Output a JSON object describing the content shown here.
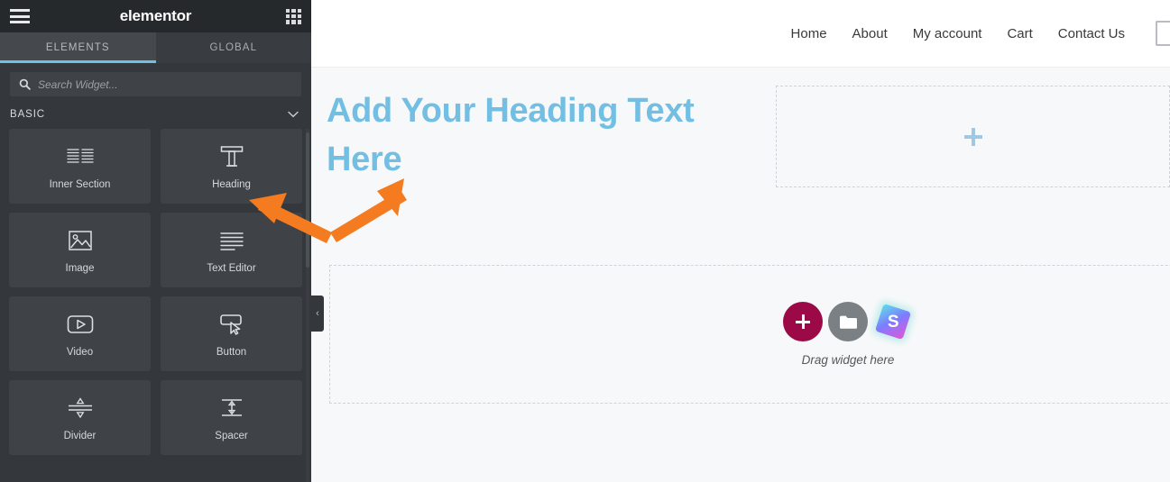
{
  "panel": {
    "brand": "elementor",
    "menu_icon": "hamburger-icon",
    "apps_icon": "apps-grid-icon",
    "tabs": [
      {
        "label": "ELEMENTS",
        "active": true
      },
      {
        "label": "GLOBAL",
        "active": false
      }
    ],
    "search": {
      "placeholder": "Search Widget...",
      "value": "",
      "icon": "search-icon"
    },
    "category": {
      "label": "BASIC",
      "chevron": "∨"
    },
    "widgets": [
      {
        "label": "Inner Section",
        "icon": "inner-section-icon"
      },
      {
        "label": "Heading",
        "icon": "heading-t-icon"
      },
      {
        "label": "Image",
        "icon": "image-icon"
      },
      {
        "label": "Text Editor",
        "icon": "text-editor-icon"
      },
      {
        "label": "Video",
        "icon": "video-play-icon"
      },
      {
        "label": "Button",
        "icon": "button-cursor-icon"
      },
      {
        "label": "Divider",
        "icon": "divider-icon"
      },
      {
        "label": "Spacer",
        "icon": "spacer-icon"
      }
    ],
    "collapse_handle": "‹",
    "colors": {
      "accent": "#6ec1e4",
      "panel_bg": "#34383c",
      "header_bg": "#26292c",
      "card_bg": "#3f4347"
    }
  },
  "preview": {
    "nav": [
      {
        "label": "Home"
      },
      {
        "label": "About"
      },
      {
        "label": "My account"
      },
      {
        "label": "Cart"
      },
      {
        "label": "Contact Us"
      }
    ],
    "heading": "Add Your Heading Text Here",
    "heading_color": "#72bfe3",
    "empty_section": {
      "add_icon": "plus-icon"
    },
    "drop_zone": {
      "label": "Drag widget here",
      "buttons": [
        {
          "name": "add-widget-button",
          "icon": "plus-icon",
          "color": "#9b0a46"
        },
        {
          "name": "template-library-button",
          "icon": "folder-icon",
          "color": "#7b8085"
        },
        {
          "name": "envato-elements-button",
          "icon": "envato-s-icon",
          "glyph": "S"
        }
      ]
    }
  },
  "annotation": {
    "arrow": "double-headed-orange-arrow",
    "color": "#f47b20"
  }
}
